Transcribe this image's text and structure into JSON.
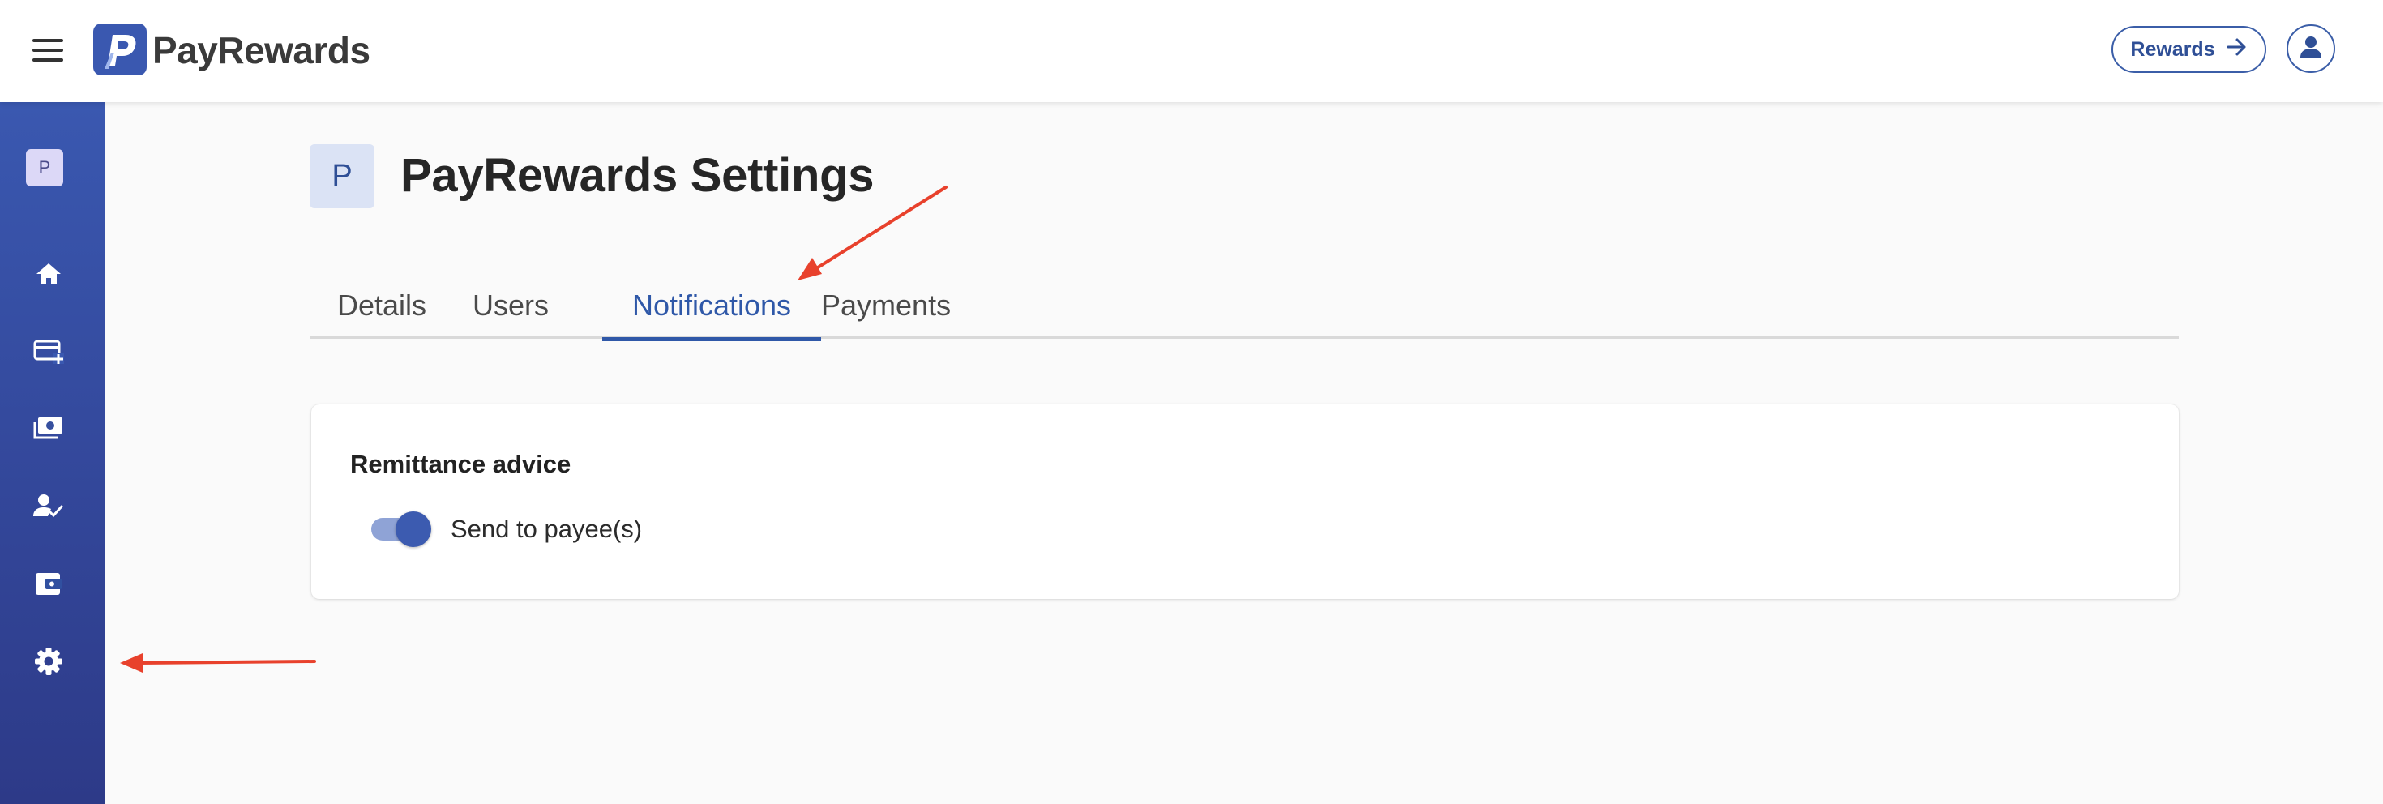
{
  "header": {
    "brand_name": "PayRewards",
    "rewards_button_label": "Rewards",
    "menu_icon": "hamburger-menu-icon",
    "user_icon": "user-account-icon"
  },
  "colors": {
    "brand_blue": "#2f58a8",
    "sidebar_top": "#3a58b0",
    "sidebar_bottom": "#2d3a88",
    "annotation_red": "#e8412c"
  },
  "sidebar": {
    "org_initial": "P",
    "items": [
      {
        "icon": "home-icon"
      },
      {
        "icon": "add-card-icon"
      },
      {
        "icon": "payments-icon"
      },
      {
        "icon": "user-check-icon"
      },
      {
        "icon": "wallet-icon"
      },
      {
        "icon": "settings-gear-icon"
      }
    ]
  },
  "page": {
    "avatar_initial": "P",
    "title": "PayRewards Settings"
  },
  "tabs": [
    {
      "label": "Details"
    },
    {
      "label": "Users"
    },
    {
      "label": "Notifications",
      "active": true
    },
    {
      "label": "Payments"
    }
  ],
  "notifications": {
    "section_title": "Remittance advice",
    "toggle_label": "Send to payee(s)",
    "toggle_on": true
  }
}
